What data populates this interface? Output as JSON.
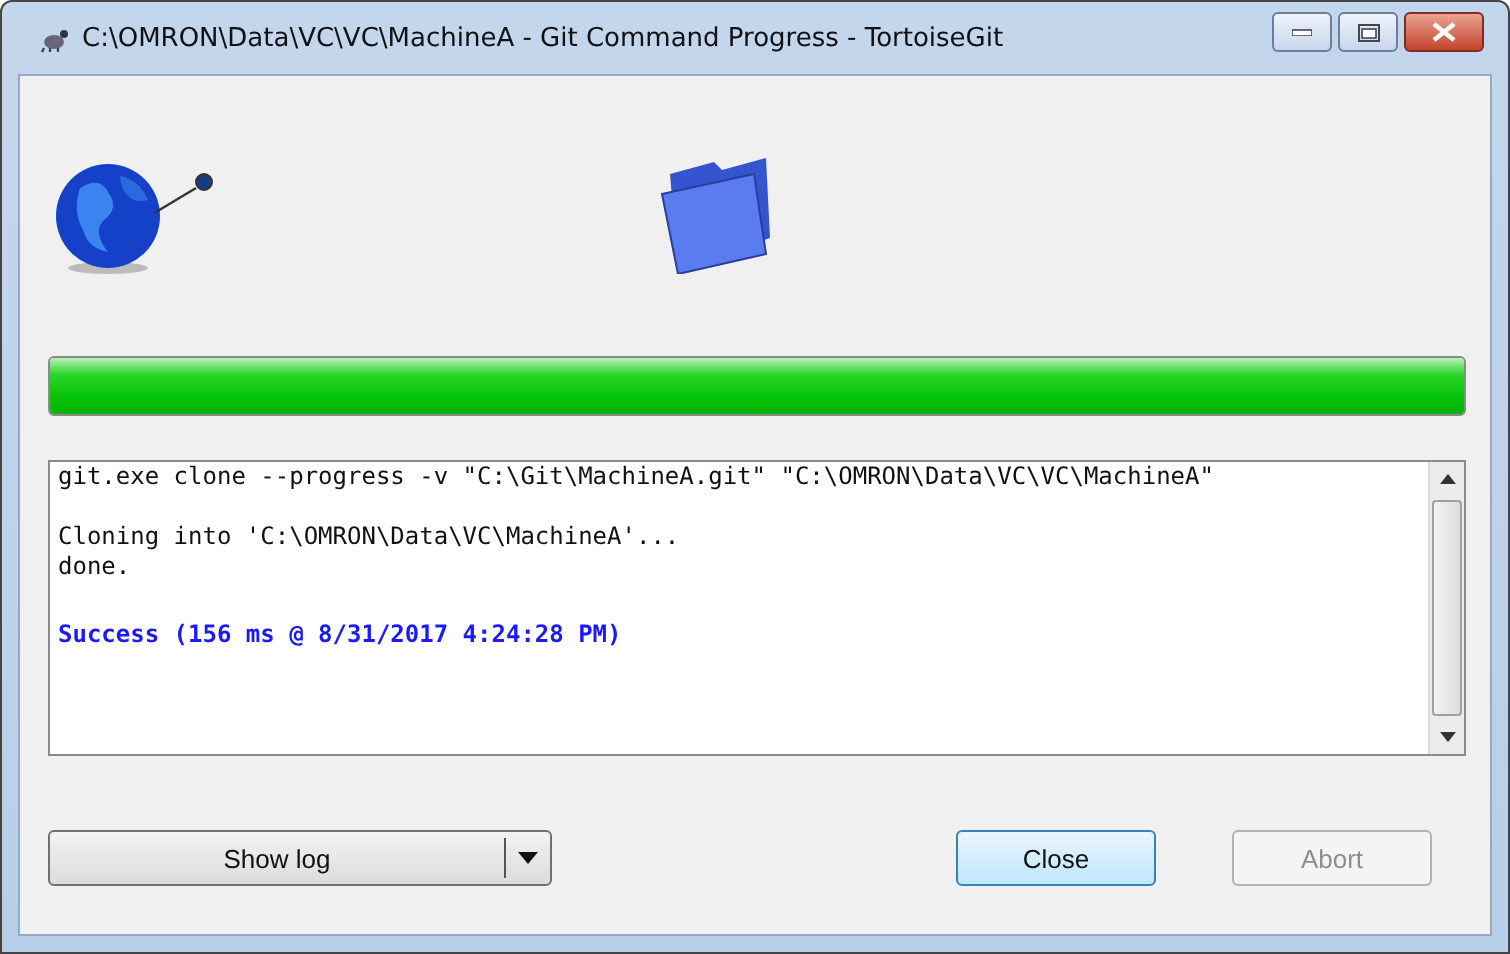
{
  "window": {
    "title": "C:\\OMRON\\Data\\VC\\VC\\MachineA - Git Command Progress - TortoiseGit"
  },
  "progress": {
    "level": 1.0
  },
  "log": {
    "lines": [
      {
        "kind": "normal",
        "text": "git.exe clone --progress -v \"C:\\Git\\MachineA.git\" \"C:\\OMRON\\Data\\VC\\VC\\MachineA\""
      },
      {
        "kind": "blank"
      },
      {
        "kind": "normal",
        "text": "Cloning into 'C:\\OMRON\\Data\\VC\\MachineA'..."
      },
      {
        "kind": "normal",
        "text": "done."
      },
      {
        "kind": "blank"
      },
      {
        "kind": "success",
        "text": "Success (156 ms @ 8/31/2017 4:24:28 PM)"
      }
    ]
  },
  "buttons": {
    "show_log": {
      "label": "Show log"
    },
    "close": {
      "label": "Close",
      "disabled": false
    },
    "abort": {
      "label": "Abort",
      "disabled": true
    }
  }
}
